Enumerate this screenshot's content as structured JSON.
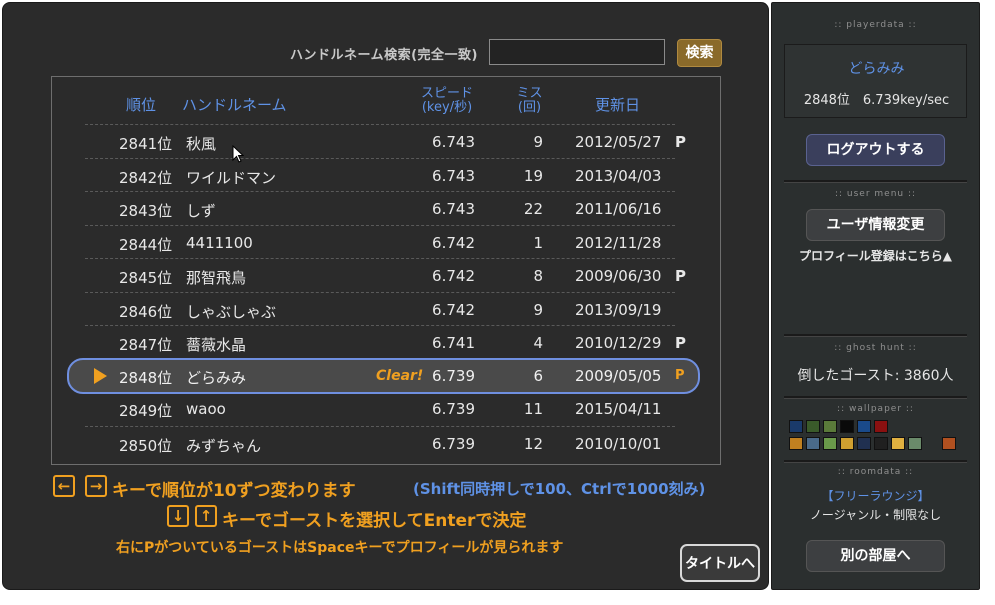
{
  "search": {
    "label": "ハンドルネーム検索(完全一致)",
    "value": "",
    "button": "検索"
  },
  "table": {
    "headers": {
      "rank": "順位",
      "name": "ハンドルネーム",
      "speed_line1": "スピード",
      "speed_line2": "(key/秒)",
      "miss_line1": "ミス",
      "miss_line2": "(回)",
      "date": "更新日"
    },
    "rows": [
      {
        "rank": "2841位",
        "name": "秋風",
        "speed": "6.743",
        "miss": "9",
        "date": "2012/05/27",
        "p": "P"
      },
      {
        "rank": "2842位",
        "name": "ワイルドマン",
        "speed": "6.743",
        "miss": "19",
        "date": "2013/04/03",
        "p": ""
      },
      {
        "rank": "2843位",
        "name": "しず",
        "speed": "6.743",
        "miss": "22",
        "date": "2011/06/16",
        "p": ""
      },
      {
        "rank": "2844位",
        "name": "4411100",
        "speed": "6.742",
        "miss": "1",
        "date": "2012/11/28",
        "p": ""
      },
      {
        "rank": "2845位",
        "name": "那智飛鳥",
        "speed": "6.742",
        "miss": "8",
        "date": "2009/06/30",
        "p": "P"
      },
      {
        "rank": "2846位",
        "name": "しゃぶしゃぶ",
        "speed": "6.742",
        "miss": "9",
        "date": "2013/09/19",
        "p": ""
      },
      {
        "rank": "2847位",
        "name": "薔薇水晶",
        "speed": "6.741",
        "miss": "4",
        "date": "2010/12/29",
        "p": "P"
      },
      {
        "rank": "2848位",
        "name": "どらみみ",
        "speed": "6.739",
        "miss": "6",
        "date": "2009/05/05",
        "p": "P",
        "clear": "Clear!"
      },
      {
        "rank": "2849位",
        "name": "waoo",
        "speed": "6.739",
        "miss": "11",
        "date": "2015/04/11",
        "p": ""
      },
      {
        "rank": "2850位",
        "name": "みずちゃん",
        "speed": "6.739",
        "miss": "12",
        "date": "2010/10/01",
        "p": ""
      }
    ]
  },
  "help": {
    "key_left": "←",
    "key_right": "→",
    "line1": "キーで順位が10ずつ変わります",
    "line1_sub": "(Shift同時押しで100、Ctrlで1000刻み)",
    "key_down": "↓",
    "key_up": "↑",
    "line2": "キーでゴーストを選択してEnterで決定",
    "line3": "右にPがついているゴーストはSpaceキーでプロフィールが見られます"
  },
  "title_button": "タイトルへ",
  "sidebar": {
    "playerdata_title": ":: playerdata ::",
    "player_name": "どらみみ",
    "player_stat": "2848位　6.739key/sec",
    "logout": "ログアウトする",
    "usermenu_title": ":: user menu ::",
    "user_info": "ユーザ情報変更",
    "profile_link": "プロフィール登録はこちら▲",
    "ghosthunt_title": ":: ghost hunt ::",
    "ghost_text": "倒したゴースト: 3860人",
    "wallpaper_title": ":: wallpaper ::",
    "roomdata_title": ":: roomdata ::",
    "room_name": "【フリーラウンジ】",
    "room_desc": "ノージャンル・制限なし",
    "room_button": "別の部屋へ"
  }
}
